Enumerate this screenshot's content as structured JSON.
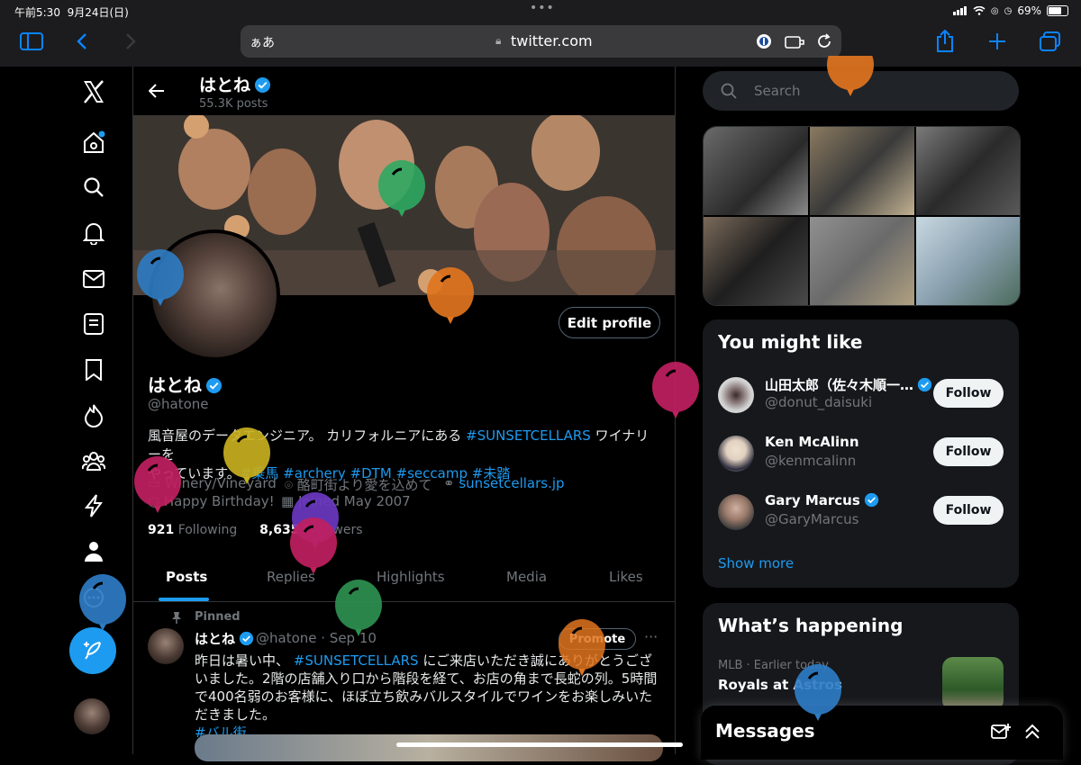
{
  "status_bar": {
    "time": "午前5:30",
    "date": "9月24日(日)",
    "battery": "69%"
  },
  "browser": {
    "aa_label": "ぁあ",
    "url": "twitter.com"
  },
  "profile_header": {
    "name": "はとね",
    "posts_count": "55.3K posts"
  },
  "profile": {
    "name": "はとね",
    "handle": "@hatone",
    "edit_button": "Edit profile",
    "bio_text_1": "風音屋のデータエンジニア。 カリフォルニアにある ",
    "bio_link_sunset": "#SUNSETCELLARS",
    "bio_text_2": " ワイナリーを",
    "bio_text_3": "やっています。",
    "bio_tags": [
      "#乗馬",
      "#archery",
      "#DTM",
      "#seccamp",
      "#未踏"
    ],
    "category": "Winery/Vineyard",
    "location": "酪町街より愛を込めて",
    "website": "sunsetcellars.jp",
    "birthday": "Happy Birthday!",
    "joined": "Joined May 2007",
    "following_count": "921",
    "following_label": "Following",
    "followers_count": "8,635",
    "followers_label": "Followers"
  },
  "tabs": [
    "Posts",
    "Replies",
    "Highlights",
    "Media",
    "Likes"
  ],
  "pinned_tweet": {
    "pinned_label": "Pinned",
    "name": "はとね",
    "handle_date": "@hatone · Sep 10",
    "promote_label": "Promote",
    "text_1": "昨日は暑い中、 ",
    "text_link": "#SUNSETCELLARS",
    "text_2": " にご来店いただき誠にありがとうございました。2階の店舗入り口から階段を経て、お店の角まで長蛇の列。5時間で400名弱のお客様に、ほぼ立ち飲みバルスタイルでワインをお楽しみいただきました。",
    "text_tag": "#バル街"
  },
  "search": {
    "placeholder": "Search"
  },
  "you_might_like": {
    "title": "You might like",
    "users": [
      {
        "name": "山田太郎（佐々木順一…",
        "handle": "@donut_daisuki",
        "verified": true,
        "follow_label": "Follow"
      },
      {
        "name": "Ken McAlinn",
        "handle": "@kenmcalinn",
        "verified": false,
        "follow_label": "Follow"
      },
      {
        "name": "Gary Marcus",
        "handle": "@GaryMarcus",
        "verified": true,
        "follow_label": "Follow"
      }
    ],
    "show_more": "Show more"
  },
  "whats_happening": {
    "title": "What’s happening",
    "trend_meta": "MLB · Earlier today",
    "trend_title": "Royals at Astros"
  },
  "messages": {
    "title": "Messages"
  },
  "colors": {
    "accent": "#1d9bf0",
    "background": "#000000",
    "panel": "#16181c",
    "muted": "#71767b"
  }
}
